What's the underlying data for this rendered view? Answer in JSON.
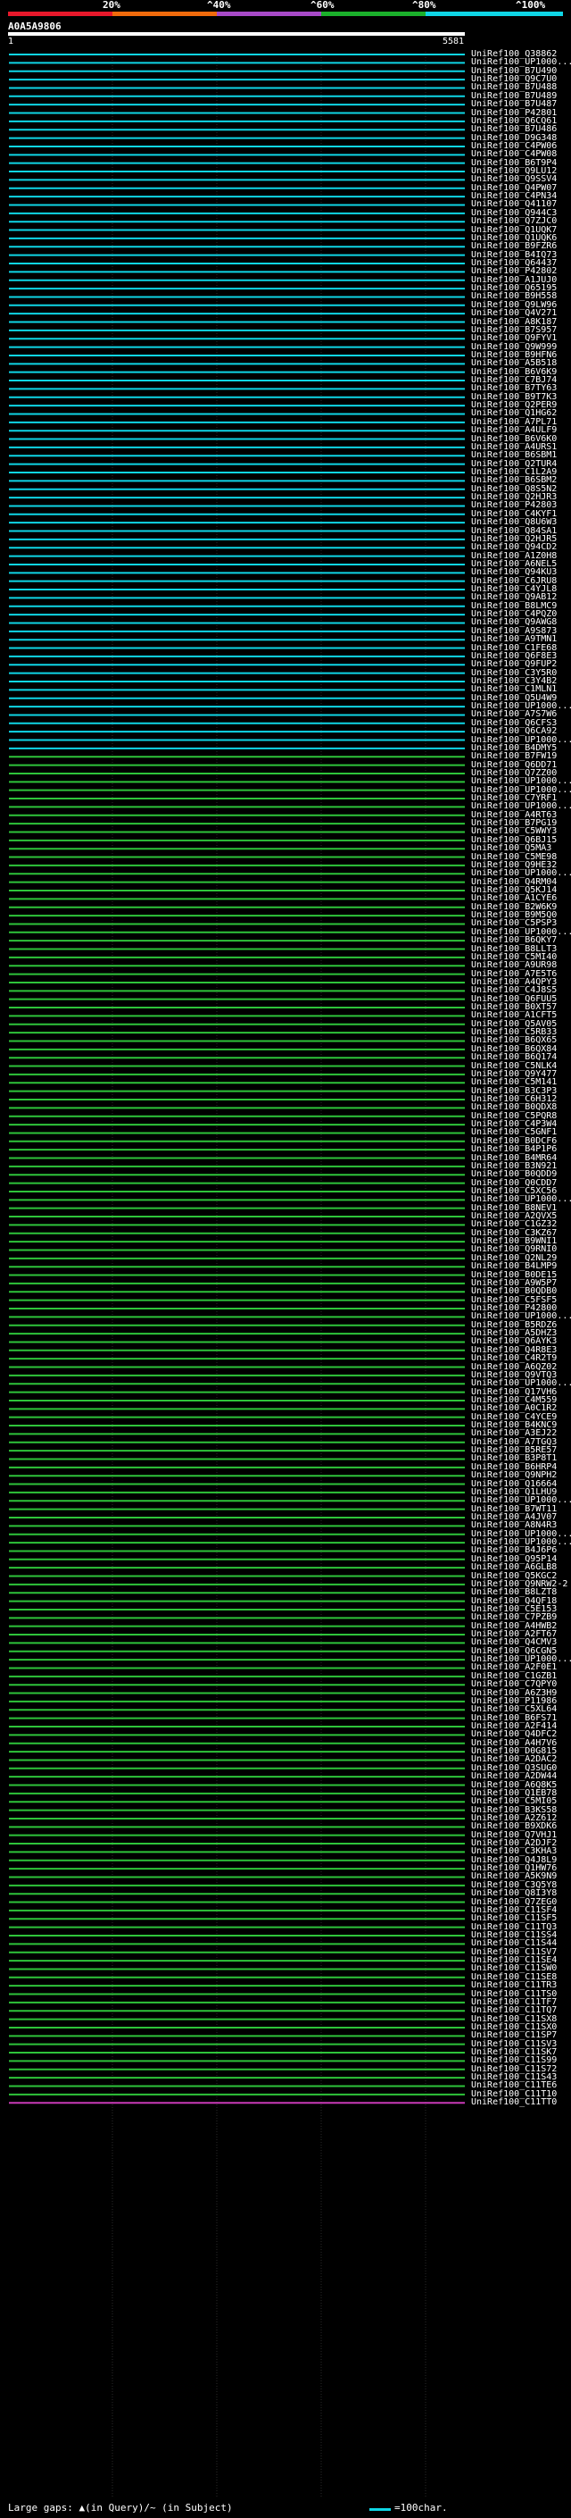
{
  "scale": {
    "labels": [
      "20%",
      "^40%",
      "^60%",
      "^80%",
      "^100%"
    ],
    "colors": [
      "#e8182b",
      "#f26b0c",
      "#a84ac8",
      "#1bb02b",
      "#0fd6e6"
    ]
  },
  "query": {
    "name": "A0A5A9806",
    "start": "1",
    "end": "5581"
  },
  "hits": [
    "UniRef100_Q38862",
    "UniRef100_UP1000...",
    "UniRef100_B7U490",
    "UniRef100_Q9C7U0",
    "UniRef100_B7U488",
    "UniRef100_B7U489",
    "UniRef100_B7U487",
    "UniRef100_P42801",
    "UniRef100_Q6CQ61",
    "UniRef100_B7U486",
    "UniRef100_D9G348",
    "UniRef100_C4PW06",
    "UniRef100_C4PW08",
    "UniRef100_B6T9P4",
    "UniRef100_Q9LU12",
    "UniRef100_Q9SSV4",
    "UniRef100_Q4PW07",
    "UniRef100_C4PN34",
    "UniRef100_Q41107",
    "UniRef100_Q944C3",
    "UniRef100_Q7ZJC0",
    "UniRef100_Q1UQK7",
    "UniRef100_Q1UQK6",
    "UniRef100_B9FZR6",
    "UniRef100_B4IQ73",
    "UniRef100_Q64437",
    "UniRef100_P42802",
    "UniRef100_A1JUJ0",
    "UniRef100_Q65195",
    "UniRef100_B9H558",
    "UniRef100_Q9LW96",
    "UniRef100_Q4V271",
    "UniRef100_A8K187",
    "UniRef100_B7S957",
    "UniRef100_Q9FYV1",
    "UniRef100_Q9W999",
    "UniRef100_B9HFN6",
    "UniRef100_A5B518",
    "UniRef100_B6V6K9",
    "UniRef100_C7BJ74",
    "UniRef100_B7TY63",
    "UniRef100_B9T7K3",
    "UniRef100_Q2PER9",
    "UniRef100_Q1HG62",
    "UniRef100_A7PL71",
    "UniRef100_A4ULF9",
    "UniRef100_B6V6K0",
    "UniRef100_A4URS1",
    "UniRef100_B6SBM1",
    "UniRef100_Q2TUR4",
    "UniRef100_C1L2A9",
    "UniRef100_B6SBM2",
    "UniRef100_Q8S5N2",
    "UniRef100_Q2HJR3",
    "UniRef100_P42803",
    "UniRef100_C4KYF1",
    "UniRef100_Q8U6W3",
    "UniRef100_Q84SA1",
    "UniRef100_Q2HJR5",
    "UniRef100_Q94CD2",
    "UniRef100_A1Z0H8",
    "UniRef100_A6NEL5",
    "UniRef100_Q94KU3",
    "UniRef100_C6JRU8",
    "UniRef100_C4YJL8",
    "UniRef100_Q9AB12",
    "UniRef100_B8LMC9",
    "UniRef100_C4PQZ0",
    "UniRef100_Q9AWG8",
    "UniRef100_A9S873",
    "UniRef100_A9TMN1",
    "UniRef100_C1FE68",
    "UniRef100_Q6F8E3",
    "UniRef100_Q9FUP2",
    "UniRef100_C3Y5R0",
    "UniRef100_C3Y4B2",
    "UniRef100_C1MLN1",
    "UniRef100_Q5U4W9",
    "UniRef100_UP1000...",
    "UniRef100_A7S7W6",
    "UniRef100_Q6CFS3",
    "UniRef100_Q6CA92",
    "UniRef100_UP1000...",
    "UniRef100_B4DMY5",
    "UniRef100_B7FW19",
    "UniRef100_Q6DD71",
    "UniRef100_Q7ZZ00",
    "UniRef100_UP1000...",
    "UniRef100_UP1000...",
    "UniRef100_C7YRF1",
    "UniRef100_UP1000...",
    "UniRef100_A4RT63",
    "UniRef100_B7PG19",
    "UniRef100_C5WWY3",
    "UniRef100_Q6BJ15",
    "UniRef100_Q5MA3",
    "UniRef100_C5ME98",
    "UniRef100_Q9HE32",
    "UniRef100_UP1000...",
    "UniRef100_Q4RM04",
    "UniRef100_Q5KJ14",
    "UniRef100_A1CYE6",
    "UniRef100_B2W6K9",
    "UniRef100_B9M5Q0",
    "UniRef100_C5PSP3",
    "UniRef100_UP1000...",
    "UniRef100_B6QKY7",
    "UniRef100_B8LLT3",
    "UniRef100_C5MI40",
    "UniRef100_A9UR98",
    "UniRef100_A7E5T6",
    "UniRef100_A4QPY3",
    "UniRef100_C4J8S5",
    "UniRef100_Q6FUU5",
    "UniRef100_B0XT57",
    "UniRef100_A1CFT5",
    "UniRef100_Q5AV05",
    "UniRef100_C5RB33",
    "UniRef100_B6QX65",
    "UniRef100_B6QX84",
    "UniRef100_B6Q174",
    "UniRef100_C5NLK4",
    "UniRef100_Q9Y477",
    "UniRef100_C5M141",
    "UniRef100_B3C3P3",
    "UniRef100_C6H312",
    "UniRef100_B0QDX8",
    "UniRef100_C5PQR8",
    "UniRef100_C4P3W4",
    "UniRef100_C5GNF1",
    "UniRef100_B0DCF6",
    "UniRef100_B4P1P6",
    "UniRef100_B4MR64",
    "UniRef100_B3N921",
    "UniRef100_B0QDD9",
    "UniRef100_Q0CDD7",
    "UniRef100_C5XC56",
    "UniRef100_UP1000...",
    "UniRef100_B8NEV1",
    "UniRef100_A2QVX5",
    "UniRef100_C1GZ32",
    "UniRef100_C3KZ67",
    "UniRef100_B9WNI1",
    "UniRef100_Q9RNI0",
    "UniRef100_Q2NL29",
    "UniRef100_B4LMP9",
    "UniRef100_B0DE15",
    "UniRef100_A9W5P7",
    "UniRef100_B0QDB0",
    "UniRef100_C5FSF5",
    "UniRef100_P42800",
    "UniRef100_UP1000...",
    "UniRef100_B5RDZ6",
    "UniRef100_A5DHZ3",
    "UniRef100_Q6AYK3",
    "UniRef100_Q4R8E3",
    "UniRef100_C4R2T9",
    "UniRef100_A6QZ02",
    "UniRef100_Q9VTQ3",
    "UniRef100_UP1000...",
    "UniRef100_Q17VH6",
    "UniRef100_C4M559",
    "UniRef100_A0C1R2",
    "UniRef100_C4YCE9",
    "UniRef100_B4KNC9",
    "UniRef100_A3EJ22",
    "UniRef100_A7TGQ3",
    "UniRef100_B5RE57",
    "UniRef100_B3P8T1",
    "UniRef100_B6HRP4",
    "UniRef100_Q9NPH2",
    "UniRef100_Q16664",
    "UniRef100_Q1LHU9",
    "UniRef100_UP1000...",
    "UniRef100_B7WT11",
    "UniRef100_A4JV07",
    "UniRef100_A8N4R3",
    "UniRef100_UP1000...",
    "UniRef100_UP1000...",
    "UniRef100_B4J6P6",
    "UniRef100_Q95P14",
    "UniRef100_A6GLB8",
    "UniRef100_Q5KGC2",
    "UniRef100_Q9NRW2-2",
    "UniRef100_B8LZT8",
    "UniRef100_Q4QF18",
    "UniRef100_C5E153",
    "UniRef100_C7PZB9",
    "UniRef100_A4HWB2",
    "UniRef100_A2FT67",
    "UniRef100_Q4CMV3",
    "UniRef100_Q6CGN5",
    "UniRef100_UP1000...",
    "UniRef100_A2F0E1",
    "UniRef100_C1GZB1",
    "UniRef100_C7QPY0",
    "UniRef100_A6Z3H9",
    "UniRef100_P11986",
    "UniRef100_C5XL64",
    "UniRef100_B6FS71",
    "UniRef100_A2F414",
    "UniRef100_Q4DFC2",
    "UniRef100_A4H7V6",
    "UniRef100_D0G815",
    "UniRef100_A2DAC2",
    "UniRef100_Q3SUG0",
    "UniRef100_A2DW44",
    "UniRef100_A6Q8K5",
    "UniRef100_Q1EB78",
    "UniRef100_C5MI05",
    "UniRef100_B3KS58",
    "UniRef100_A2Z612",
    "UniRef100_B9XDK6",
    "UniRef100_Q7VHJ1",
    "UniRef100_A2DJF2",
    "UniRef100_C3KHA3",
    "UniRef100_Q4J8L9",
    "UniRef100_Q1HW76",
    "UniRef100_A5K9N9",
    "UniRef100_C3Q5Y8",
    "UniRef100_Q8I3Y8",
    "UniRef100_Q7ZEG0",
    "UniRef100_C11SF4",
    "UniRef100_C11SF5",
    "UniRef100_C11TQ3",
    "UniRef100_C11SS4",
    "UniRef100_C11S44",
    "UniRef100_C11SV7",
    "UniRef100_C11SE4",
    "UniRef100_C11SW0",
    "UniRef100_C11SE8",
    "UniRef100_C11TR3",
    "UniRef100_C11TS0",
    "UniRef100_C11TF7",
    "UniRef100_C11TQ7",
    "UniRef100_C11SX8",
    "UniRef100_C11SX0",
    "UniRef100_C11SP7",
    "UniRef100_C11SV3",
    "UniRef100_C11SK7",
    "UniRef100_C11S99",
    "UniRef100_C11S72",
    "UniRef100_C11S43",
    "UniRef100_C11TE6",
    "UniRef100_C11T10",
    "UniRef100_C11TT0"
  ],
  "footer": {
    "gaps": "Large gaps: ▲(in Query)/~ (in Subject)",
    "scale": "=100char."
  }
}
